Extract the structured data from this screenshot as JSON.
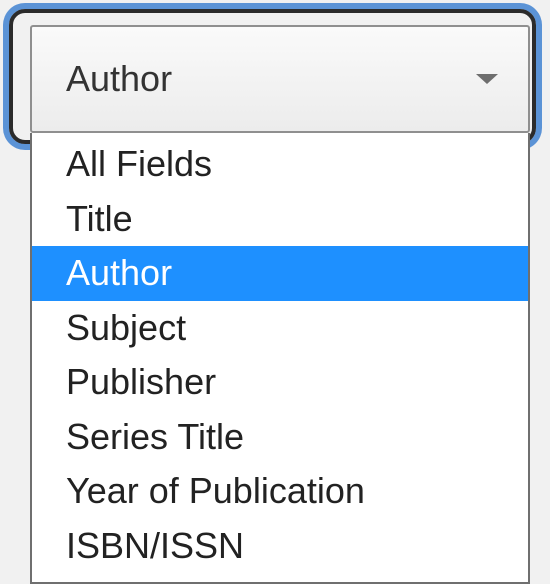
{
  "select": {
    "value": "Author",
    "caret_icon": "triangle-down-icon"
  },
  "options": [
    {
      "label": "All Fields"
    },
    {
      "label": "Title"
    },
    {
      "label": "Author",
      "selected": true
    },
    {
      "label": "Subject"
    },
    {
      "label": "Publisher"
    },
    {
      "label": "Series Title"
    },
    {
      "label": "Year of Publication"
    },
    {
      "label": "ISBN/ISSN"
    }
  ],
  "colors": {
    "selected_background": "#1e90ff",
    "selected_text": "#ffffff",
    "focus_ring": "#5b93d6"
  }
}
